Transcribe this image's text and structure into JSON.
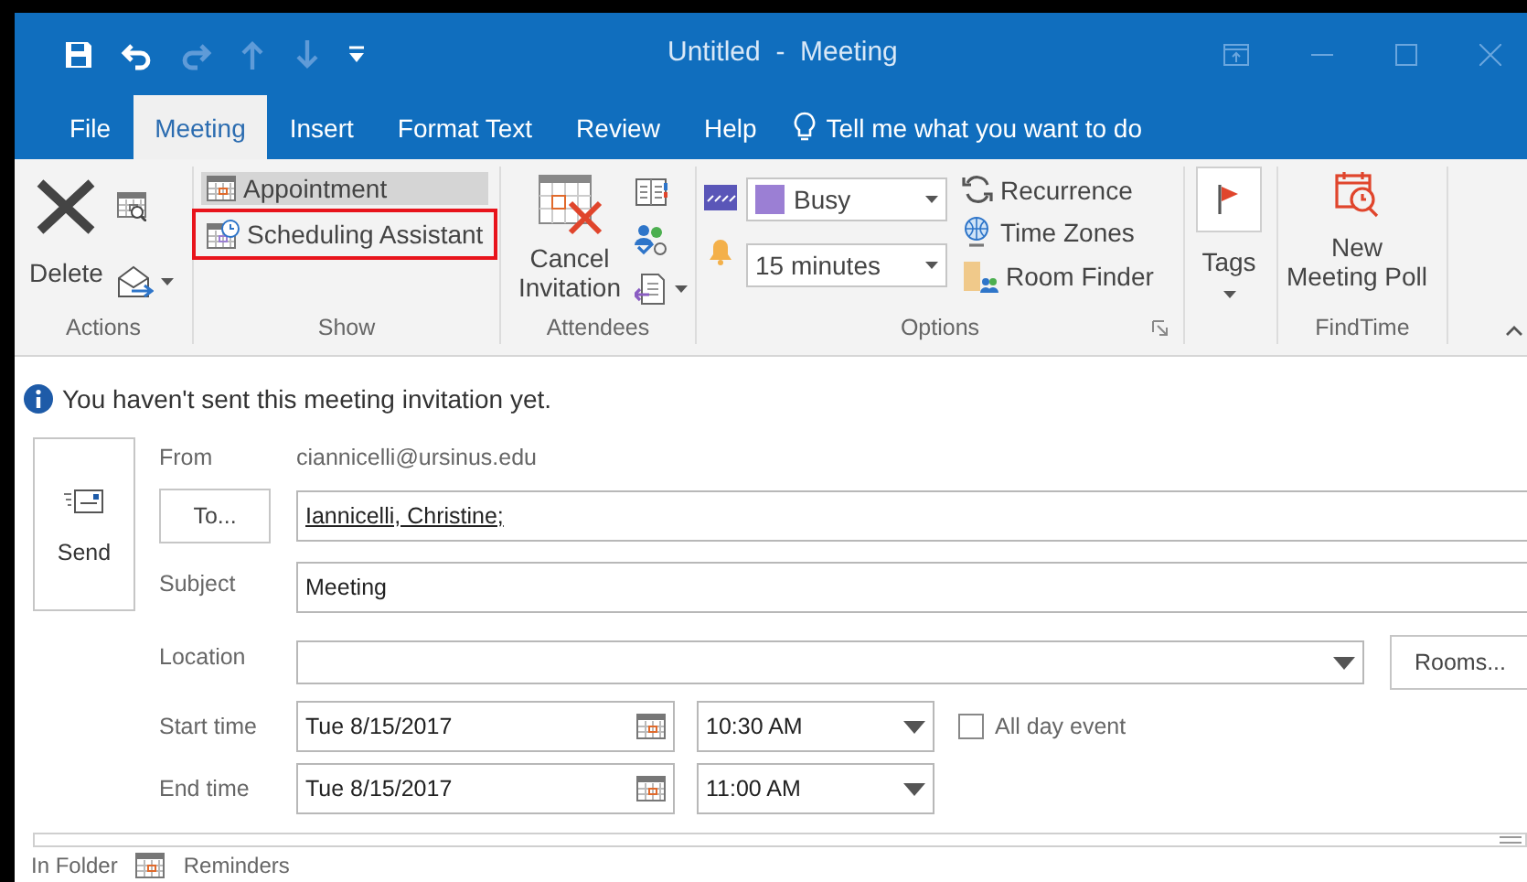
{
  "window": {
    "title": "Untitled  -  Meeting"
  },
  "quick_access": [
    {
      "kind": "save",
      "disabled": false
    },
    {
      "kind": "undo",
      "disabled": false
    },
    {
      "kind": "redo",
      "disabled": true
    },
    {
      "kind": "up",
      "disabled": true
    },
    {
      "kind": "down",
      "disabled": true
    },
    {
      "kind": "customize",
      "disabled": false
    }
  ],
  "tabs": [
    {
      "label": "File",
      "selected": false
    },
    {
      "label": "Meeting",
      "selected": true
    },
    {
      "label": "Insert",
      "selected": false
    },
    {
      "label": "Format Text",
      "selected": false
    },
    {
      "label": "Review",
      "selected": false
    },
    {
      "label": "Help",
      "selected": false
    }
  ],
  "tell_me": {
    "placeholder": "Tell me what you want to do"
  },
  "ribbon": {
    "actions": {
      "label": "Actions",
      "delete_button": "Delete"
    },
    "show": {
      "label": "Show",
      "items": [
        {
          "label": "Appointment",
          "selected": true,
          "highlighted": false
        },
        {
          "label": "Scheduling Assistant",
          "selected": false,
          "highlighted": true
        }
      ]
    },
    "attendees": {
      "label": "Attendees",
      "cancel_button": "Cancel Invitation"
    },
    "options": {
      "label": "Options",
      "show_as": {
        "value": "Busy",
        "color": "#9b7fd4"
      },
      "reminder": {
        "value": "15 minutes"
      },
      "buttons": [
        {
          "kind": "recurrence",
          "label": "Recurrence"
        },
        {
          "kind": "time_zones",
          "label": "Time Zones"
        },
        {
          "kind": "room_finder",
          "label": "Room Finder"
        }
      ]
    },
    "tags": {
      "label": "Tags"
    },
    "findtime": {
      "label": "FindTime",
      "button": "New Meeting Poll"
    }
  },
  "info_bar": {
    "message": "You haven't sent this meeting invitation yet."
  },
  "form": {
    "send_button": "Send",
    "from_label": "From",
    "from_value": "ciannicelli@ursinus.edu",
    "to_button": "To...",
    "to_value": "Iannicelli, Christine;",
    "subject_label": "Subject",
    "subject_value": "Meeting",
    "location_label": "Location",
    "rooms_button": "Rooms...",
    "start_label": "Start time",
    "start_date": "Tue 8/15/2017",
    "start_time": "10:30 AM",
    "all_day": {
      "label": "All day event",
      "checked": false
    },
    "end_label": "End time",
    "end_date": "Tue 8/15/2017",
    "end_time": "11:00 AM"
  },
  "footer": {
    "items": [
      "In Folder",
      "Reminders"
    ]
  }
}
